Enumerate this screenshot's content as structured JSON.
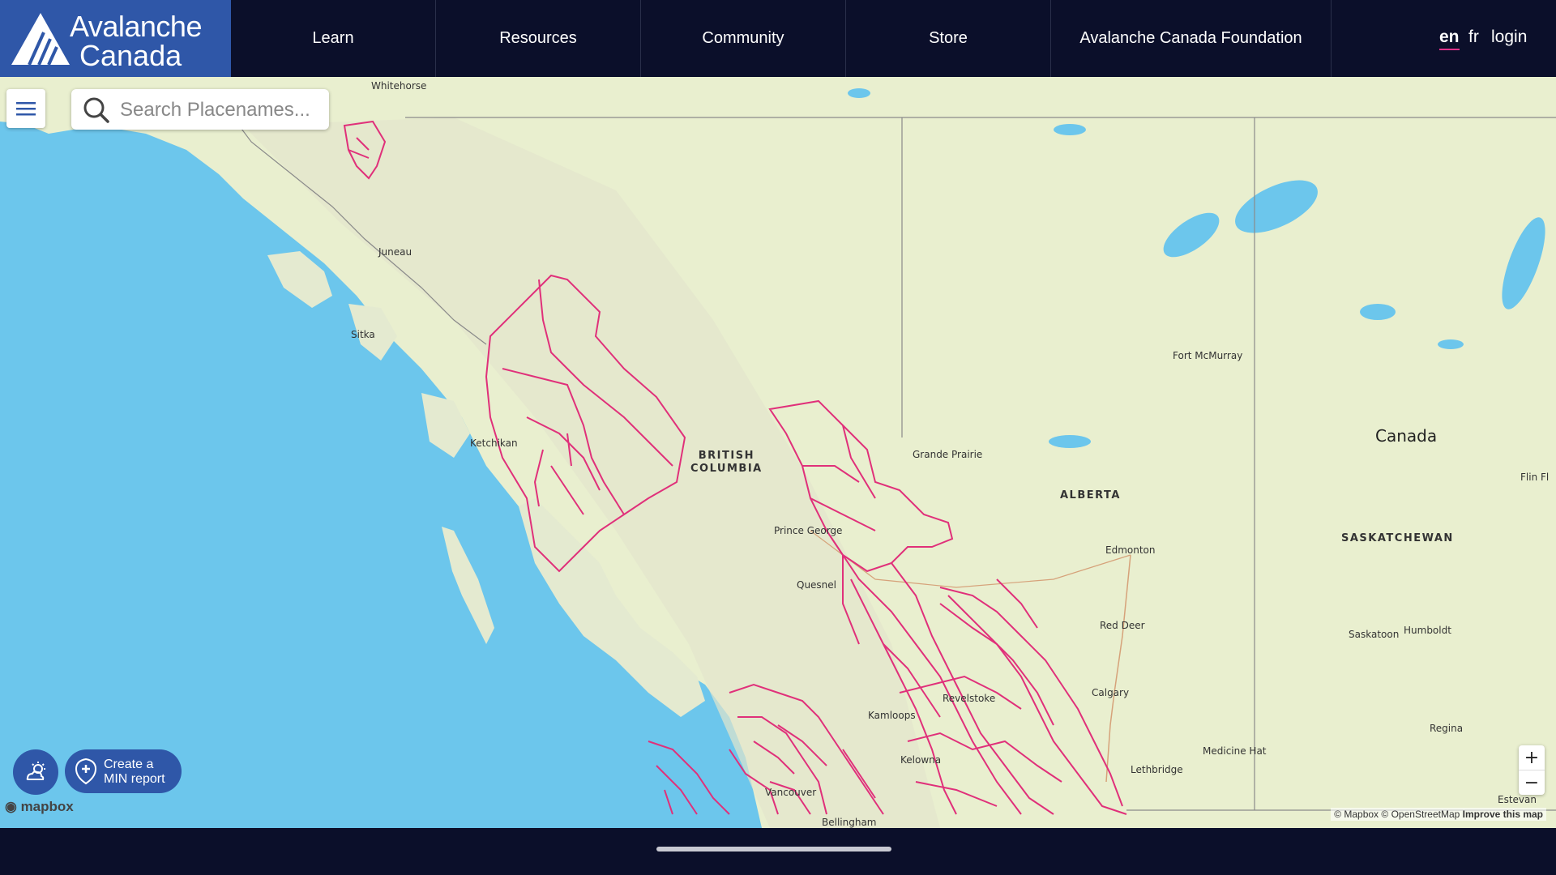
{
  "header": {
    "logo_line1": "Avalanche",
    "logo_line2": "Canada",
    "nav": [
      {
        "label": "Learn"
      },
      {
        "label": "Resources"
      },
      {
        "label": "Community"
      },
      {
        "label": "Store"
      },
      {
        "label": "Avalanche Canada Foundation"
      }
    ],
    "lang_en": "en",
    "lang_fr": "fr",
    "login": "login"
  },
  "search": {
    "placeholder": "Search Placenames..."
  },
  "map": {
    "places": {
      "whitehorse": "Whitehorse",
      "juneau": "Juneau",
      "sitka": "Sitka",
      "ketchikan": "Ketchikan",
      "prince_george": "Prince George",
      "quesnel": "Quesnel",
      "kamloops": "Kamloops",
      "kelowna": "Kelowna",
      "revelstoke": "Revelstoke",
      "vancouver": "Vancouver",
      "bellingham": "Bellingham",
      "grande_prairie": "Grande Prairie",
      "fort_mcmurray": "Fort McMurray",
      "edmonton": "Edmonton",
      "red_deer": "Red Deer",
      "calgary": "Calgary",
      "lethbridge": "Lethbridge",
      "medicine_hat": "Medicine Hat",
      "saskatoon": "Saskatoon",
      "humboldt": "Humboldt",
      "regina": "Regina",
      "estevan": "Estevan",
      "flin_flon": "Flin Fl"
    },
    "regions": {
      "bc_line1": "BRITISH",
      "bc_line2": "COLUMBIA",
      "alberta": "ALBERTA",
      "saskatchewan": "SASKATCHEWAN"
    },
    "country": "Canada",
    "colors": {
      "water": "#6cc6ec",
      "land": "#e9efcf",
      "forecast_regions": "#e0307a",
      "brand": "#2f57a8"
    }
  },
  "controls": {
    "min_report_line1": "Create a",
    "min_report_line2": "MIN report",
    "zoom_in": "+",
    "zoom_out": "−",
    "mapbox": "mapbox"
  },
  "attribution": {
    "mapbox": "© Mapbox",
    "osm": "© OpenStreetMap",
    "improve": "Improve this map"
  }
}
